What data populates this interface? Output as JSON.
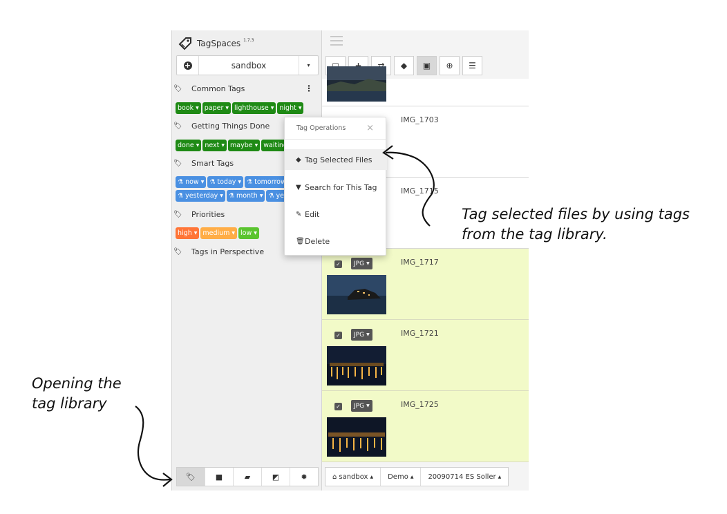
{
  "app": {
    "name": "TagSpaces",
    "version": "1.7.3"
  },
  "location": {
    "name": "sandbox",
    "caret": "▾"
  },
  "tag_groups": [
    {
      "title": "Common Tags",
      "tags": [
        {
          "label": "book",
          "color": "#1f8a15"
        },
        {
          "label": "paper",
          "color": "#1f8a15"
        },
        {
          "label": "lighthouse",
          "color": "#1f8a15"
        },
        {
          "label": "night",
          "color": "#1f8a15"
        }
      ]
    },
    {
      "title": "Getting Things Done",
      "tags": [
        {
          "label": "done",
          "color": "#1f8a15"
        },
        {
          "label": "next",
          "color": "#1f8a15"
        },
        {
          "label": "maybe",
          "color": "#1f8a15"
        },
        {
          "label": "waiting",
          "color": "#1f8a15"
        }
      ]
    },
    {
      "title": "Smart Tags",
      "rows": [
        [
          {
            "label": "now",
            "color": "#4a90e2"
          },
          {
            "label": "today",
            "color": "#4a90e2"
          },
          {
            "label": "tomorrow",
            "color": "#4a90e2"
          }
        ],
        [
          {
            "label": "yesterday",
            "color": "#4a90e2"
          },
          {
            "label": "month",
            "color": "#4a90e2"
          },
          {
            "label": "year",
            "color": "#4a90e2"
          }
        ]
      ]
    },
    {
      "title": "Priorities",
      "tags": [
        {
          "label": "high",
          "color": "#ff7537"
        },
        {
          "label": "medium",
          "color": "#ffad46"
        },
        {
          "label": "low",
          "color": "#5ac42f"
        }
      ]
    },
    {
      "title": "Tags in Perspective",
      "tags": []
    }
  ],
  "sidebar_bottom": [
    "tags-icon",
    "folder-icon",
    "chat-icon",
    "external-icon",
    "gear-icon"
  ],
  "toolbar": [
    "checkbox-icon",
    "plus-icon",
    "retweet-icon",
    "tag-icon",
    "image-icon",
    "zoom-icon",
    "list-icon"
  ],
  "files": [
    {
      "name": "",
      "selected": false,
      "thumb": "harbor-dusk"
    },
    {
      "name": "IMG_1703",
      "selected": false,
      "thumb": "none"
    },
    {
      "name": "IMG_1715",
      "selected": false,
      "thumb": "none"
    },
    {
      "name": "IMG_1717",
      "selected": true,
      "ext": "JPG",
      "thumb": "castle-night"
    },
    {
      "name": "IMG_1721",
      "selected": true,
      "ext": "JPG",
      "thumb": "harbor-lights"
    },
    {
      "name": "IMG_1725",
      "selected": true,
      "ext": "JPG",
      "thumb": "harbor-lights-2"
    }
  ],
  "breadcrumb": {
    "location": "sandbox",
    "folder1": "Demo",
    "folder2": "20090714 ES Soller"
  },
  "popup": {
    "title": "Tag Operations",
    "close": "×",
    "items": [
      "Tag Selected Files",
      "Search for This Tag",
      "Edit",
      "Delete"
    ]
  },
  "annotations": {
    "right_line1": "Tag selected files by using tags",
    "right_line2": "from the tag library.",
    "left_line1": "Opening the",
    "left_line2": "tag library"
  }
}
